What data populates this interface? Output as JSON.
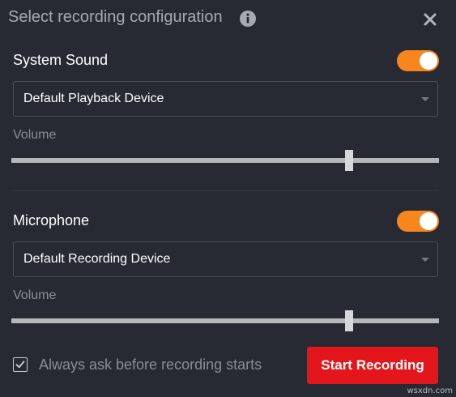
{
  "dialog": {
    "title": "Select recording configuration",
    "icons": {
      "info": "info-icon",
      "close": "close-icon"
    }
  },
  "system_sound": {
    "label": "System Sound",
    "enabled": true,
    "device": "Default Playback Device",
    "volume_label": "Volume",
    "volume_fraction": 0.79
  },
  "microphone": {
    "label": "Microphone",
    "enabled": true,
    "device": "Default Recording Device",
    "volume_label": "Volume",
    "volume_fraction": 0.79
  },
  "footer": {
    "checkbox_label": "Always ask before recording starts",
    "checkbox_checked": true,
    "start_button_label": "Start Recording"
  },
  "watermark": "wsxdn.com",
  "colors": {
    "accent": "#f7861c",
    "start_button": "#e3161b",
    "background": "#272a33"
  }
}
